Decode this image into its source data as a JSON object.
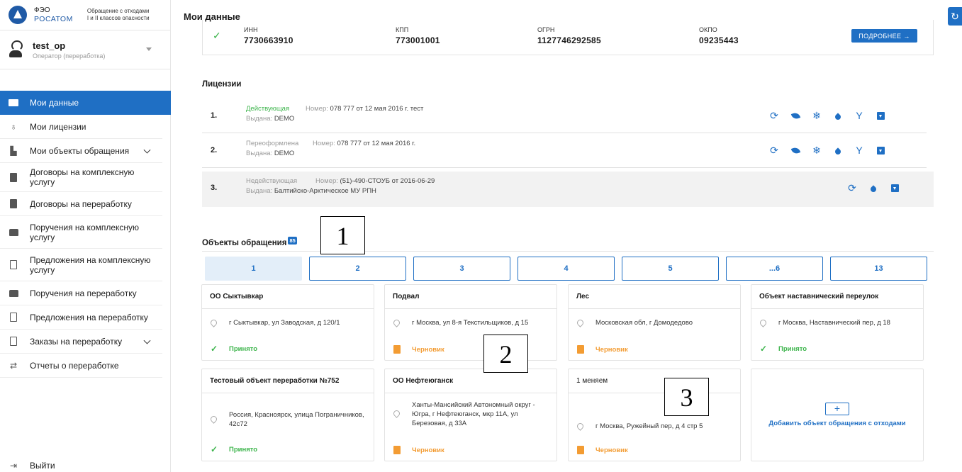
{
  "logo": {
    "line1": "ФЭО",
    "line2": "РОСАТОМ",
    "sub1": "Обращение с отходами",
    "sub2": "I и II классов опасности"
  },
  "user": {
    "name": "test_op",
    "role": "Оператор (переработка)"
  },
  "menu": [
    {
      "label": "Мои данные"
    },
    {
      "label": "Мои лицензии"
    },
    {
      "label": "Мои объекты обращения"
    },
    {
      "label": "Договоры на комплексную услугу"
    },
    {
      "label": "Договоры на переработку"
    },
    {
      "label": "Поручения на комплексную услугу"
    },
    {
      "label": "Предложения на комплексную услугу"
    },
    {
      "label": "Поручения на переработку"
    },
    {
      "label": "Предложения на переработку"
    },
    {
      "label": "Заказы на переработку"
    },
    {
      "label": "Отчеты о переработке"
    }
  ],
  "logout": "Выйти",
  "page_title": "Мои данные",
  "requisites": {
    "labels": [
      "ИНН",
      "КПП",
      "ОГРН",
      "ОКПО"
    ],
    "values": [
      "7730663910",
      "773001001",
      "1127746292585",
      "09235443"
    ],
    "more_button": "ПОДРОБНЕЕ →"
  },
  "licenses": {
    "title": "Лицензии",
    "number_label": "Номер:",
    "issued_label": "Выдана:",
    "rows": [
      {
        "n": "1.",
        "status": "Действующая",
        "number": "078 777 от 12 мая 2016 г. тест",
        "issued": "DEMO"
      },
      {
        "n": "2.",
        "status": "Переоформлена",
        "number": "078 777 от 12 мая 2016 г.",
        "issued": "DEMO"
      },
      {
        "n": "3.",
        "status": "Недействующая",
        "number": "(51)-490-СТОУБ от 2016-06-29",
        "issued": "Балтийско-Арктическое МУ РПН"
      }
    ]
  },
  "objects": {
    "title": "Объекты обращения",
    "count": "85",
    "pages": [
      "1",
      "2",
      "3",
      "4",
      "5",
      "...6",
      "13"
    ],
    "cards": [
      {
        "title": "ОО Сыктывкар",
        "address": "г Сыктывкар, ул Заводская, д 120/1",
        "status": "Принято"
      },
      {
        "title": "Подвал",
        "address": "г Москва, ул 8-я Текстильщиков, д 15",
        "status": "Черновик"
      },
      {
        "title": "Лес",
        "address": "Московская обл, г Домодедово",
        "status": "Черновик"
      },
      {
        "title": "Объект наставнический переулок",
        "address": "г Москва, Наставнический пер, д 18",
        "status": "Принято"
      },
      {
        "title": "Тестовый объект переработки №752",
        "address": "Россия, Красноярск, улица Пограничников, 42с72",
        "status": "Принято"
      },
      {
        "title": "ОО Нефтеюганск",
        "address": "Ханты-Мансийский Автономный округ - Югра, г Нефтеюганск, мкр 11А, ул Березовая, д 33А",
        "status": "Черновик"
      },
      {
        "title": "1 меняем",
        "address": "г Москва, Ружейный пер, д 4 стр 5",
        "status": "Черновик"
      }
    ],
    "add_label": "Добавить объект обращения с отходами",
    "add_plus": "+"
  },
  "callouts": [
    "1",
    "2",
    "3"
  ],
  "colors": {
    "accent": "#1f6fc4",
    "ok": "#3cb44b",
    "draft": "#f39c33"
  }
}
